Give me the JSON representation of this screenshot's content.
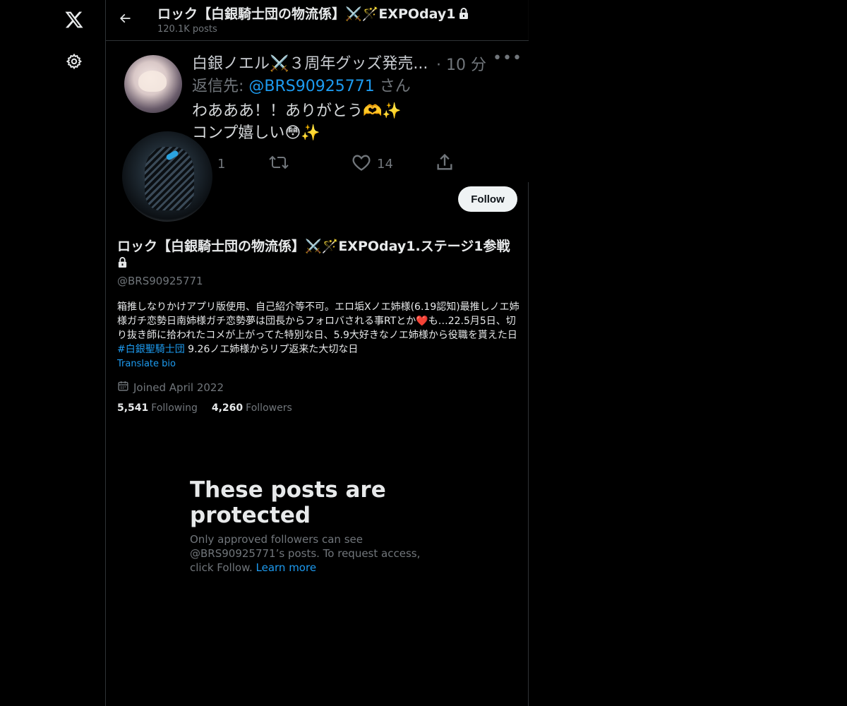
{
  "header": {
    "title": "ロック【白銀騎士団の物流係】⚔️🪄EXPOday1",
    "posts_count": "120.1K posts"
  },
  "banner": {
    "name": "白銀ノエル⚔️３周年グッズ発売...",
    "time": "· 10 分",
    "more": "•••",
    "reply_prefix": "返信先: ",
    "reply_mention": "@BRS90925771",
    "reply_suffix": " さん",
    "body_line1": "わあああ！！ありがとう🫶✨",
    "body_line2": "コンプ嬉しい😳✨",
    "reply_count": "1",
    "like_count": "14"
  },
  "profile": {
    "follow_label": "Follow",
    "name": "ロック【白銀騎士団の物流係】⚔️🪄EXPOday1.ステージ1参戦",
    "handle": "@BRS90925771",
    "bio_main": "箱推しなりかけアプリ版使用、自己紹介等不可。エロ垢Xノエ姉様(6.19認知)最推しノエ姉様ガチ恋勢日南姉様ガチ恋勢夢は団長からフォロバされる事RTとか❤️も…22.5月5日、切り抜き師に拾われたコメが上がってた特別な日、5.9大好きなノエ姉様から役職を貰えた日 ",
    "bio_hashtag": "#白銀聖騎士団",
    "bio_tail": " 9.26ノエ姉様からリプ返来た大切な日",
    "translate_bio": "Translate bio",
    "joined": "Joined April 2022",
    "following_count": "5,541",
    "following_label": "Following",
    "followers_count": "4,260",
    "followers_label": "Followers"
  },
  "protected": {
    "title": "These posts are protected",
    "text": "Only approved followers can see @BRS90925771’s posts. To request access, click Follow. ",
    "learn_more": "Learn more"
  },
  "icons": [
    "x-logo-icon",
    "settings-gear-icon",
    "back-arrow-icon",
    "lock-icon",
    "reply-icon",
    "retweet-icon",
    "like-icon",
    "share-icon",
    "calendar-icon"
  ],
  "colors": {
    "background": "#000000",
    "text": "#e7e9ea",
    "muted": "#71767b",
    "accent": "#1d9bf0",
    "border": "#2f3336"
  }
}
